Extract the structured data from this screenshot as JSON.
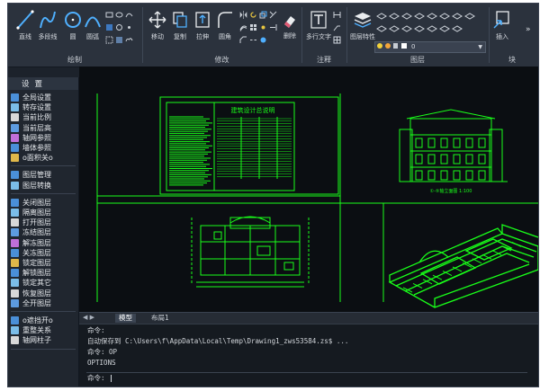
{
  "colors": {
    "cad_green": "#19ff19",
    "background": "#0b0e12",
    "ribbon": "#2b323d"
  },
  "ribbon": {
    "draw": {
      "group_label": "绘制",
      "line": "直线",
      "polyline": "多段线",
      "circle": "圆",
      "arc": "圆弧"
    },
    "modify": {
      "group_label": "修改",
      "move": "移动",
      "copy": "复制",
      "stretch": "拉伸",
      "fillet": "圆角",
      "erase": "删除"
    },
    "annotate": {
      "group_label": "注释",
      "mtext": "多行文字"
    },
    "layers": {
      "group_label": "图层",
      "layer_props": "图层特性",
      "current_layer": "0"
    },
    "block": {
      "group_label": "块",
      "insert": "插入",
      "more": "»"
    }
  },
  "left_panel": {
    "title": "设置",
    "items": [
      {
        "label": "全局设置",
        "icon": "globe-settings-icon"
      },
      {
        "label": "转存设置",
        "icon": "save-settings-icon"
      },
      {
        "label": "当前比例",
        "icon": "scale-icon"
      },
      {
        "label": "当前层高",
        "icon": "floor-height-icon"
      },
      {
        "label": "轴网参照",
        "icon": "axis-grid-icon"
      },
      {
        "label": "墙体参照",
        "icon": "wall-reference-icon"
      },
      {
        "label": "o面积关o",
        "icon": "area-toggle-icon"
      }
    ],
    "items2": [
      {
        "label": "图层管理",
        "icon": "layer-manager-icon"
      },
      {
        "label": "图层转换",
        "icon": "layer-convert-icon"
      }
    ],
    "items3": [
      {
        "label": "关闭图层",
        "icon": "layer-off-icon"
      },
      {
        "label": "隔离图层",
        "icon": "layer-isolate-icon"
      },
      {
        "label": "打开图层",
        "icon": "layer-on-icon"
      },
      {
        "label": "冻结图层",
        "icon": "layer-freeze-icon"
      },
      {
        "label": "解冻图层",
        "icon": "layer-thaw-icon"
      },
      {
        "label": "关冻图层",
        "icon": "layer-offfreeze-icon"
      },
      {
        "label": "锁定图层",
        "icon": "layer-lock-icon"
      },
      {
        "label": "解锁图层",
        "icon": "layer-unlock-icon"
      },
      {
        "label": "锁定其它",
        "icon": "lock-others-icon"
      },
      {
        "label": "恢复图层",
        "icon": "layer-restore-icon"
      },
      {
        "label": "全开图层",
        "icon": "layer-all-on-icon"
      }
    ],
    "items4": [
      {
        "label": "o遮挡开o",
        "icon": "occlusion-toggle-icon"
      },
      {
        "label": "重整关系",
        "icon": "rebuild-relation-icon"
      },
      {
        "label": "轴网柱子",
        "icon": "axis-column-icon"
      }
    ]
  },
  "drawing": {
    "sheet_title": "建筑设计总说明",
    "elevation_caption": "①-⑤轴立面图 1:100"
  },
  "tabs": {
    "model": "模型",
    "layout1": "布局1"
  },
  "command": {
    "lines": [
      "命令:",
      "自动保存到 C:\\Users\\f\\AppData\\Local\\Temp\\Drawing1_zws53584.zs$ ...",
      "命令: OP",
      "OPTIONS"
    ],
    "prompt": "命令:"
  }
}
